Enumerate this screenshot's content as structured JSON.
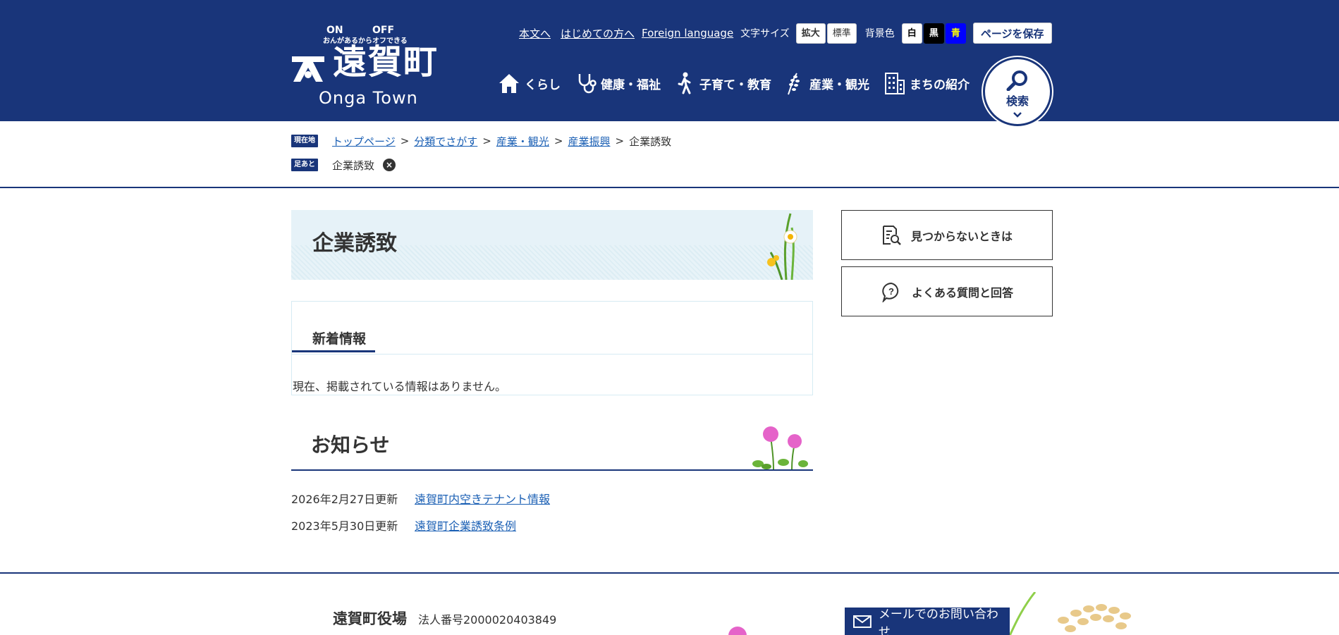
{
  "header": {
    "logo": {
      "catch_on": "ON",
      "catch_off": "OFF",
      "catch_text": "おんがあるからオフできる",
      "name": "遠賀町",
      "name_en": "Onga Town"
    },
    "utility": {
      "skip_link": "本文へ",
      "first_link": "はじめての方へ",
      "foreign_link": "Foreign language",
      "font_size_label": "文字サイズ",
      "font_enlarge": "拡大",
      "font_standard": "標準",
      "bg_label": "背景色",
      "bg_white": "白",
      "bg_black": "黒",
      "bg_blue": "青",
      "save_page": "ページを保存"
    },
    "gnav": [
      {
        "label": "くらし",
        "icon": "house-icon"
      },
      {
        "label": "健康・福祉",
        "icon": "stethoscope-icon"
      },
      {
        "label": "子育て・教育",
        "icon": "walking-person-icon"
      },
      {
        "label": "産業・観光",
        "icon": "rice-plant-icon"
      },
      {
        "label": "まちの紹介",
        "icon": "building-icon"
      }
    ],
    "search_label": "検索"
  },
  "breadcrumb": {
    "current_tag": "現在地",
    "items": [
      "トップページ",
      "分類でさがす",
      "産業・観光",
      "産業振興"
    ],
    "current": "企業誘致",
    "footprint_tag": "足あと",
    "footprint_item": "企業誘致"
  },
  "main": {
    "title": "企業誘致",
    "news": {
      "heading": "新着情報",
      "empty": "現在、掲載されている情報はありません。"
    },
    "notice": {
      "heading": "お知らせ",
      "items": [
        {
          "date": "2026年2月27日更新",
          "title": "遠賀町内空きテナント情報"
        },
        {
          "date": "2023年5月30日更新",
          "title": "遠賀町企業誘致条例"
        }
      ]
    }
  },
  "side": {
    "not_found": "見つからないときは",
    "faq": "よくある質問と回答"
  },
  "footer": {
    "office": "遠賀町役場",
    "corp_number": "法人番号2000020403849",
    "mail_contact": "メールでのお問い合わせ"
  },
  "colors": {
    "primary": "#19357a",
    "link": "#1a5fb4",
    "title_bg": "#e6f2f8"
  }
}
